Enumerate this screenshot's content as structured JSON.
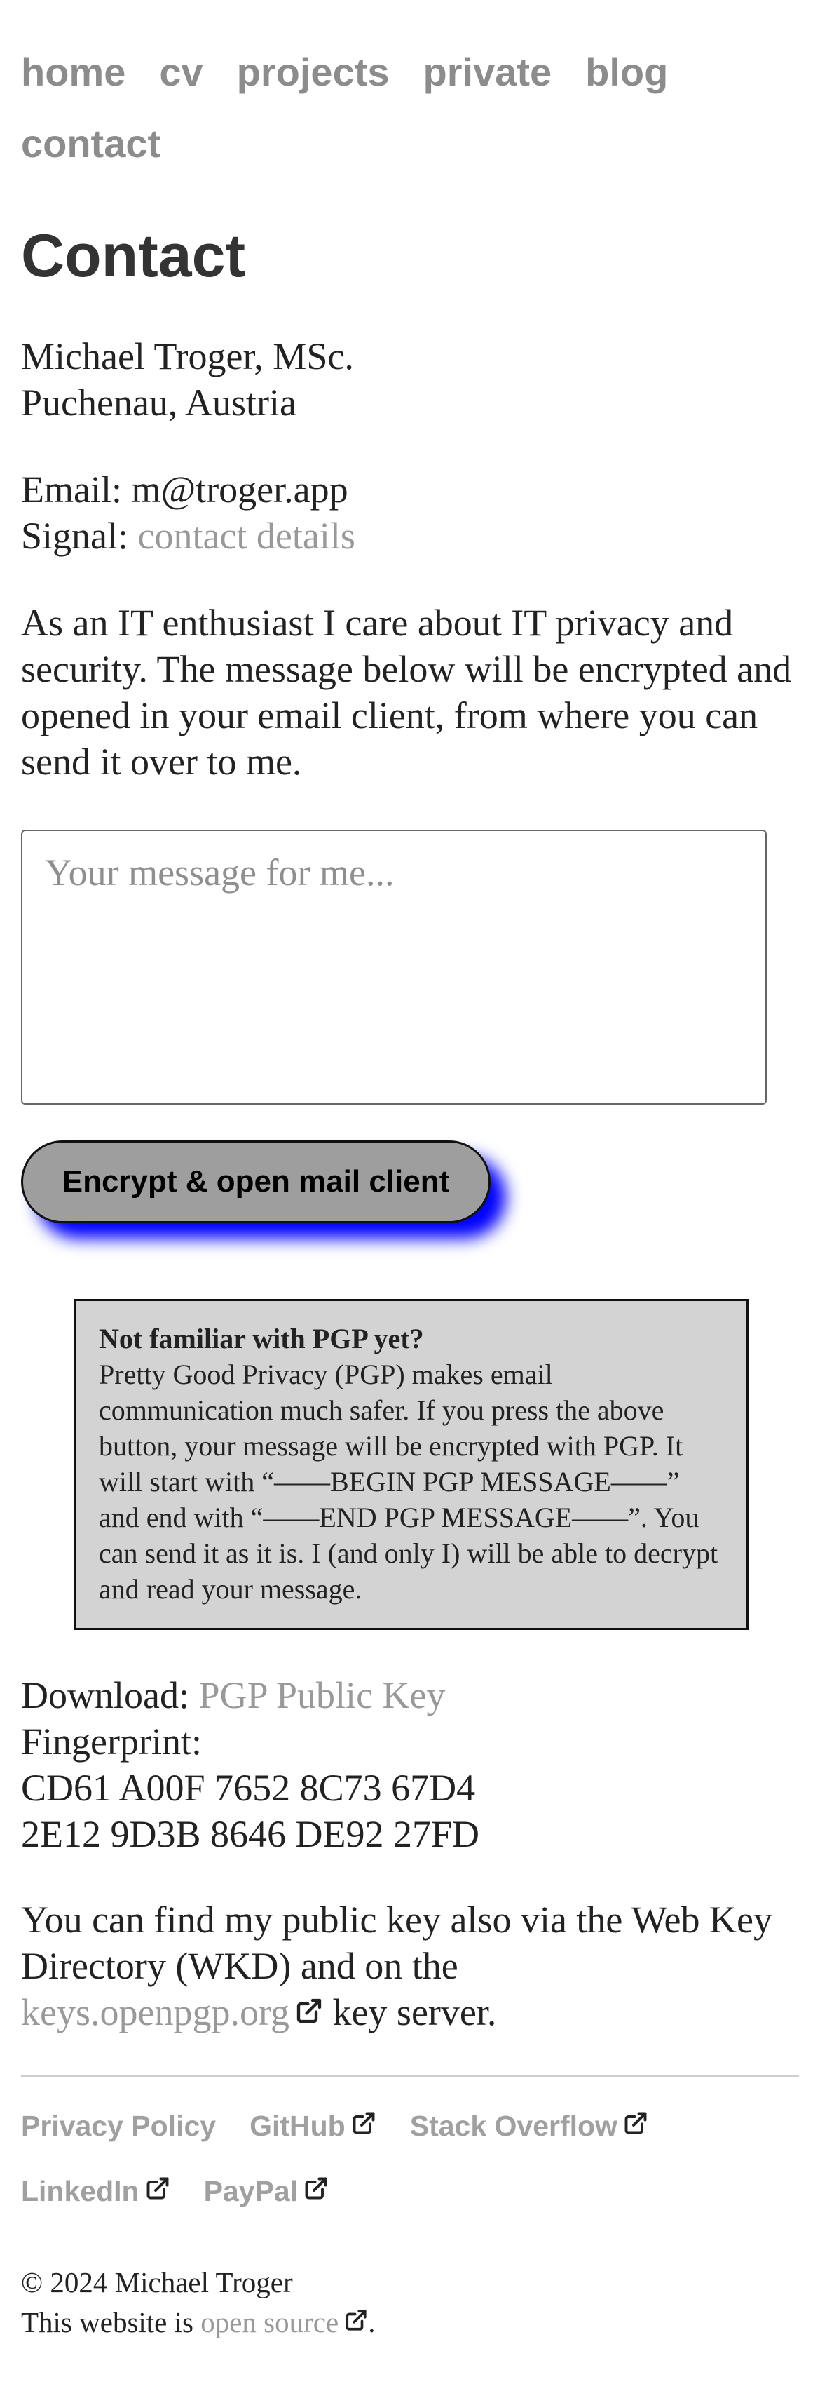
{
  "nav": {
    "items": [
      "home",
      "cv",
      "projects",
      "private",
      "blog",
      "contact"
    ]
  },
  "page_title": "Contact",
  "address": {
    "name": "Michael Troger, MSc.",
    "location": "Puchenau, Austria"
  },
  "contact": {
    "email_label": "Email: ",
    "email_value": "m@troger.app",
    "signal_label": "Signal: ",
    "signal_link": "contact details"
  },
  "intro_text": "As an IT enthusiast I care about IT privacy and security. The message below will be encrypted and opened in your email client, from where you can send it over to me.",
  "message_form": {
    "placeholder": "Your message for me...",
    "submit_label": "Encrypt & open mail client",
    "button_shadow_color": "#0000ff",
    "button_color": "#9e9e9e"
  },
  "pgp_info": {
    "title": "Not familiar with PGP yet?",
    "body": "Pretty Good Privacy (PGP) makes email communication much safer. If you press the above button, your message will be encrypted with PGP. It will start with “——BEGIN PGP MESSAGE——” and end with “——END PGP MESSAGE——”. You can send it as it is. I (and only I) will be able to decrypt and read your message.",
    "background_color": "#d3d3d3"
  },
  "key": {
    "download_label": "Download: ",
    "download_link": "PGP Public Key",
    "fingerprint_label": "Fingerprint:",
    "fingerprint_line1": "CD61 A00F 7652 8C73 67D4",
    "fingerprint_line2": "2E12 9D3B 8646 DE92 27FD"
  },
  "wkd": {
    "text_before": "You can find my public key also via the Web Key Directory (WKD) and on the",
    "link": "keys.openpgp.org",
    "text_after": " key server."
  },
  "footer": {
    "links": [
      {
        "label": "Privacy Policy",
        "external": false
      },
      {
        "label": "GitHub",
        "external": true
      },
      {
        "label": "Stack Overflow",
        "external": true
      },
      {
        "label": "LinkedIn",
        "external": true
      },
      {
        "label": "PayPal",
        "external": true
      }
    ],
    "copyright": "© 2024 Michael Troger",
    "source_prefix": "This website is ",
    "source_link": "open source",
    "source_suffix": "."
  },
  "colors": {
    "link": "#999999",
    "nav": "#8c8c8c",
    "text": "#222222"
  }
}
